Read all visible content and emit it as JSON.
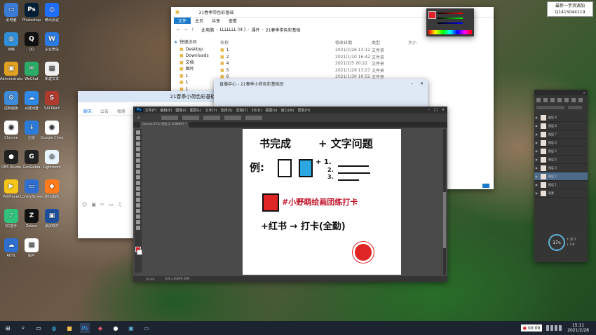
{
  "desktop": {
    "icons": [
      {
        "label": "此电脑",
        "color": "#3a7bd5",
        "glyph": "▭"
      },
      {
        "label": "Photoshop",
        "color": "#001e36",
        "glyph": "Ps"
      },
      {
        "label": "腾讯会议",
        "color": "#1e6fff",
        "glyph": "◎"
      },
      {
        "label": "网络",
        "color": "#2f8fd8",
        "glyph": "◍"
      },
      {
        "label": "QQ",
        "color": "#111111",
        "glyph": "Q"
      },
      {
        "label": "企业微信",
        "color": "#2c7be5",
        "glyph": "W"
      },
      {
        "label": "Administrator",
        "color": "#e0a020",
        "glyph": "▣"
      },
      {
        "label": "WeChat",
        "color": "#2aae67",
        "glyph": "✉"
      },
      {
        "label": "新建文本",
        "color": "#f0f0f0",
        "glyph": "▤"
      },
      {
        "label": "控制面板",
        "color": "#3d8bd9",
        "glyph": "⚙"
      },
      {
        "label": "百度网盘",
        "color": "#2e8ae6",
        "glyph": "☁"
      },
      {
        "label": "SAI Paint",
        "color": "#b03a2e",
        "glyph": "S"
      },
      {
        "label": "Chrome",
        "color": "#ffffff",
        "glyph": "◉"
      },
      {
        "label": "迅雷",
        "color": "#2d7bd8",
        "glyph": "↓"
      },
      {
        "label": "Google Chrome",
        "color": "#ffffff",
        "glyph": "◉"
      },
      {
        "label": "OBS Studio",
        "color": "#222222",
        "glyph": "●"
      },
      {
        "label": "GeoGebra",
        "color": "#222222",
        "glyph": "G"
      },
      {
        "label": "Lightroom",
        "color": "#e8f4ff",
        "glyph": "◎"
      },
      {
        "label": "PotPlayer",
        "color": "#f5c518",
        "glyph": "▶"
      },
      {
        "label": "LonelyScreen",
        "color": "#2f6fd0",
        "glyph": "▭"
      },
      {
        "label": "DingTalk",
        "color": "#ff7a1a",
        "glyph": "◆"
      },
      {
        "label": "QQ音乐",
        "color": "#31c27c",
        "glyph": "♪"
      },
      {
        "label": "Zotero",
        "color": "#111111",
        "glyph": "Z"
      },
      {
        "label": "录屏软件",
        "color": "#1d4f9c",
        "glyph": "▣"
      },
      {
        "label": "ADSL",
        "color": "#2f6fd0",
        "glyph": "☁"
      },
      {
        "label": "图片",
        "color": "#ffffff",
        "glyph": "▤"
      }
    ]
  },
  "watermark": {
    "line1": "最新一手资源加",
    "line2": "Q1415044119"
  },
  "explorer": {
    "title": "21春季带色彩基础",
    "tabs": [
      "文件",
      "主页",
      "共享",
      "查看"
    ],
    "breadcrumb": [
      "此电脑",
      "LLLLLLL (H:)",
      "课件",
      "21春季带色彩基础"
    ],
    "columns": [
      "名称",
      "修改日期",
      "类型",
      "大小"
    ],
    "sidebar": [
      "快速访问",
      "Desktop",
      "Downloads",
      "文档",
      "图片",
      "1",
      "1",
      "1"
    ],
    "rows": [
      {
        "name": "1",
        "date": "2021/2/26 13:12",
        "type": "文件夹"
      },
      {
        "name": "2",
        "date": "2021/1/10 16:42",
        "type": "文件夹"
      },
      {
        "name": "4",
        "date": "2021/2/5 20:22",
        "type": "文件夹"
      },
      {
        "name": "5",
        "date": "2021/1/29 13:27",
        "type": "文件夹"
      },
      {
        "name": "6",
        "date": "2021/1/30 10:52",
        "type": "文件夹"
      }
    ]
  },
  "chatwin": {
    "title": "21春季小荷色彩基础班",
    "tabs": [
      "聊天",
      "公告",
      "相册"
    ]
  },
  "videowin": {
    "title": "直播中心 - 21春季小荷色彩基础班"
  },
  "photoshop": {
    "logo": "Ps",
    "menu": [
      "文件(F)",
      "编辑(E)",
      "图像(I)",
      "图层(L)",
      "文字(Y)",
      "选择(S)",
      "滤镜(T)",
      "3D(D)",
      "视图(V)",
      "窗口(W)",
      "帮助(H)"
    ],
    "doc_tab": "Canvas 51% (图层 2, RGB/8#) *",
    "zoom": "50.9%",
    "doc_size": "文档:3.00M/9.40M",
    "canvas": {
      "line1_a": "书完成",
      "line1_b": "+ 文字问题",
      "line2_a": "例:",
      "line2_b": "+ 1.",
      "line2_c": "2.",
      "line2_d": "3.",
      "line3_a": "#小野萌绘画团练打卡",
      "line4": "+红书 → 打卡(全勤)"
    }
  },
  "layers_panel": {
    "items": [
      "图层 9",
      "图层 8",
      "图层 7",
      "图层 6",
      "图层 5",
      "图层 4",
      "图层 3",
      "图层 2",
      "图层 1",
      "背景"
    ],
    "gauge_value": "17",
    "gauge_unit": "%",
    "speed_up": "25.7",
    "speed_down": "1.8"
  },
  "taskbar": {
    "rec_time": "00:09",
    "time": "15:11",
    "date": "2021/2/28"
  }
}
